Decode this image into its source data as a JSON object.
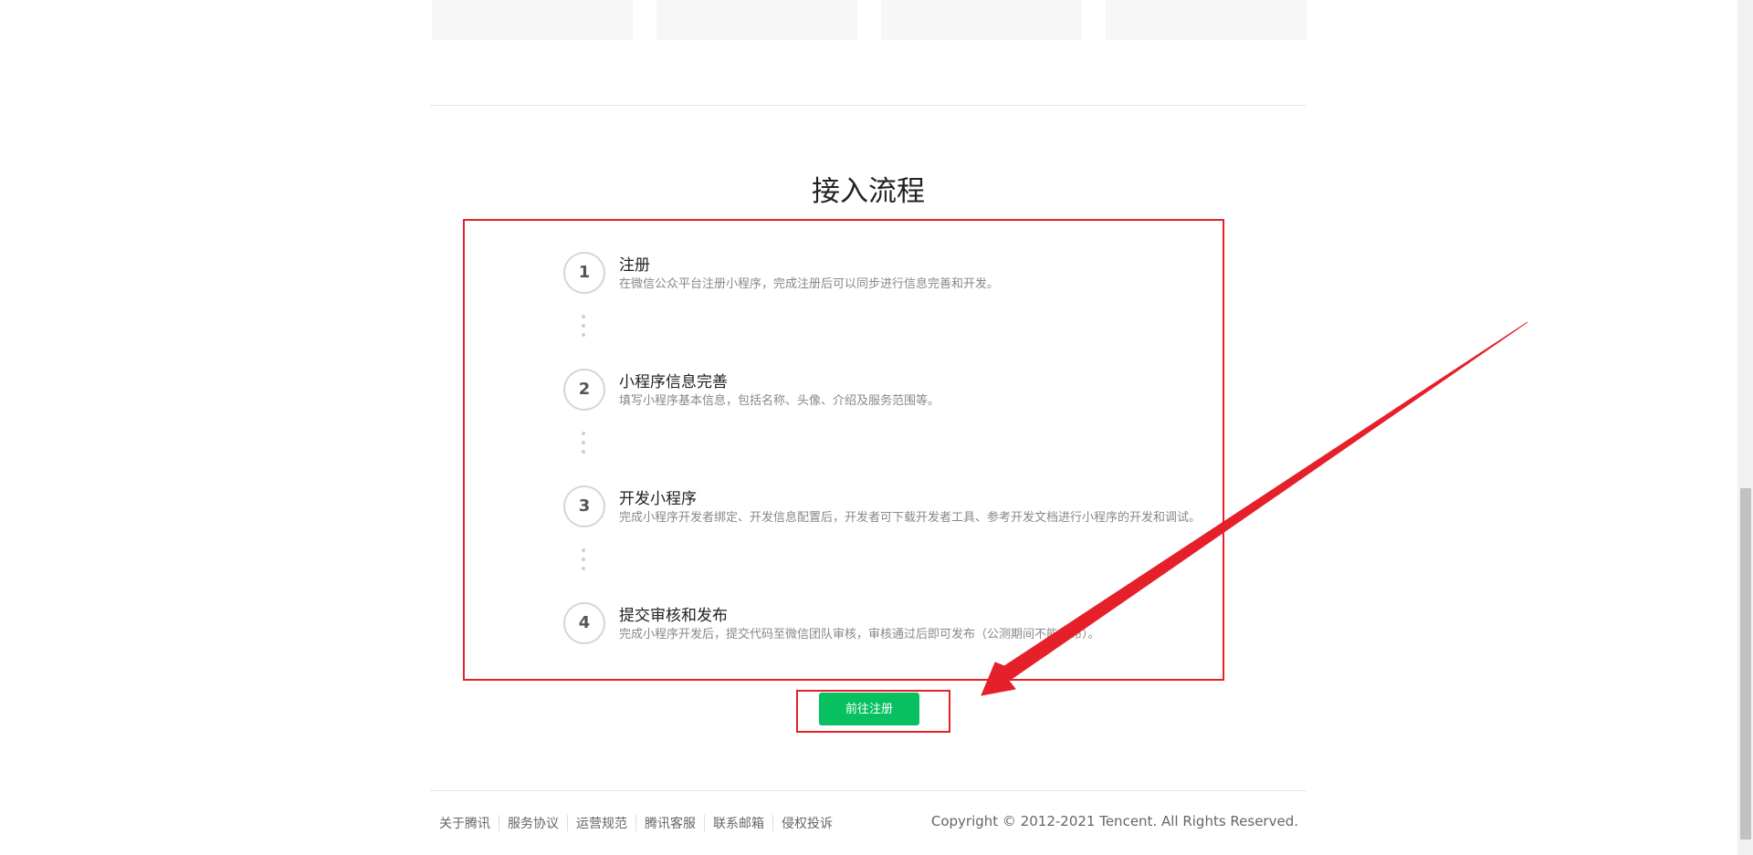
{
  "section": {
    "title": "接入流程"
  },
  "steps": [
    {
      "number": "1",
      "title": "注册",
      "description": "在微信公众平台注册小程序，完成注册后可以同步进行信息完善和开发。"
    },
    {
      "number": "2",
      "title": "小程序信息完善",
      "description": "填写小程序基本信息，包括名称、头像、介绍及服务范围等。"
    },
    {
      "number": "3",
      "title": "开发小程序",
      "description": "完成小程序开发者绑定、开发信息配置后，开发者可下载开发者工具、参考开发文档进行小程序的开发和调试。"
    },
    {
      "number": "4",
      "title": "提交审核和发布",
      "description": "完成小程序开发后，提交代码至微信团队审核，审核通过后即可发布（公测期间不能发布）。"
    }
  ],
  "action": {
    "register_label": "前往注册"
  },
  "footer": {
    "links": [
      "关于腾讯",
      "服务协议",
      "运营规范",
      "腾讯客服",
      "联系邮箱",
      "侵权投诉"
    ],
    "copyright": "Copyright © 2012-2021 Tencent. All Rights Reserved."
  },
  "colors": {
    "accent_green": "#07c160",
    "annotation_red": "#e5202a"
  }
}
